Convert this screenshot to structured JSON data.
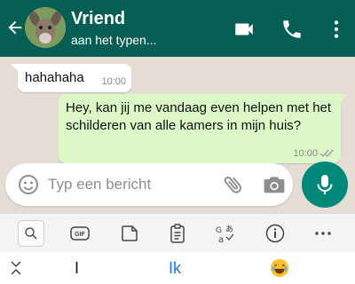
{
  "header": {
    "contact_name": "Vriend",
    "status": "aan het typen..."
  },
  "messages": [
    {
      "direction": "incoming",
      "text": "hahahaha",
      "time": "10:00"
    },
    {
      "direction": "outgoing",
      "text": "Hey, kan jij me vandaag even helpen met het schilderen van alle kamers in mijn huis?",
      "time": "10:00",
      "read_status": "delivered-double-check"
    }
  ],
  "composer": {
    "placeholder": "Typ een bericht"
  },
  "keyboard_toolbar": {
    "items": [
      "search-icon",
      "gif-icon",
      "sticker-icon",
      "clipboard-icon",
      "translate-icon",
      "info-icon",
      "more-icon"
    ],
    "gif_label": "GIF"
  },
  "suggestions": {
    "left": "I",
    "middle": "Ik",
    "right_emoji": "laughing-face"
  },
  "colors": {
    "header": "#075e54",
    "outgoing_bubble": "#dcf8c6",
    "incoming_bubble": "#ffffff",
    "mic_button": "#00897b",
    "suggestion_highlight": "#1a73e8"
  }
}
